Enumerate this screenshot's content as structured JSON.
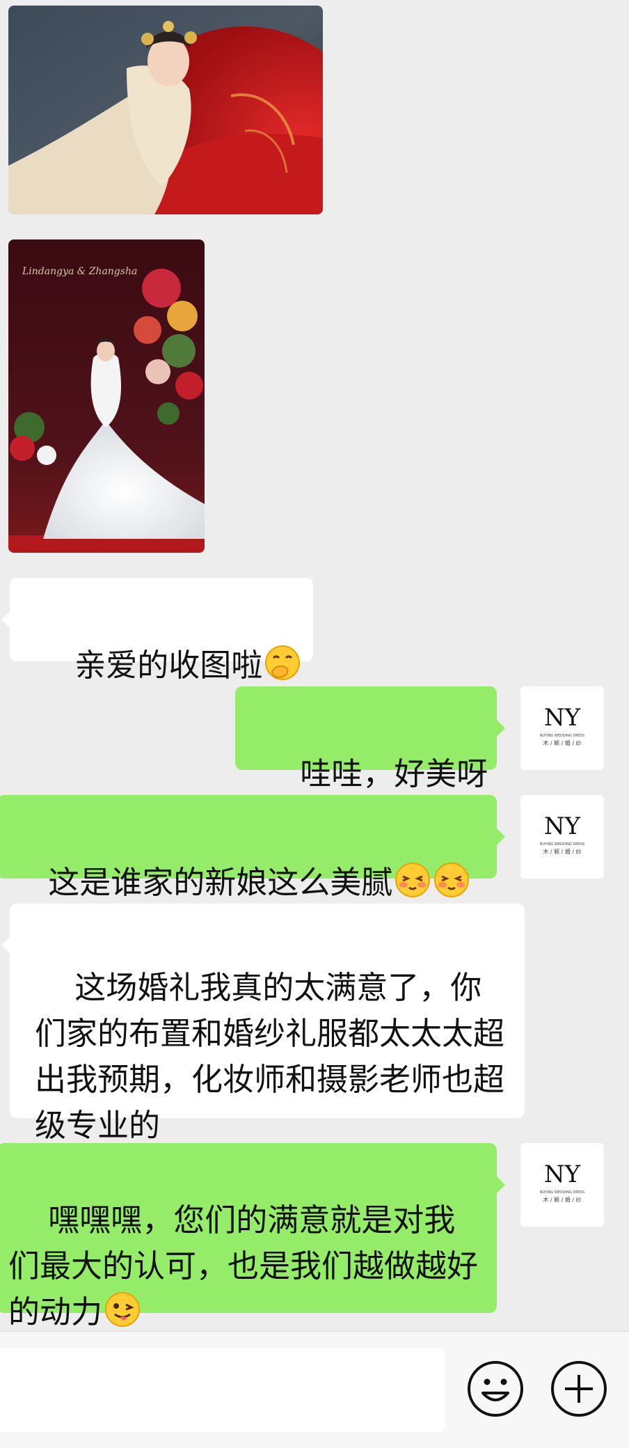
{
  "messages": {
    "msg_text_1": "亲爱的收图啦",
    "msg_text_2": "哇哇，好美呀",
    "msg_text_3": "这是谁家的新娘这么美腻",
    "msg_text_4": "这场婚礼我真的太满意了，你们家的布置和婚纱礼服都太太太超出我预期，化妆师和摄影老师也超级专业的",
    "msg_text_5": "嘿嘿嘿，您们的满意就是对我们最大的认可，也是我们越做越好的动力"
  },
  "avatar": {
    "logo_text": "NY",
    "brand_en": "NUYING WEDDING DRESS",
    "brand_cn": "木 / 颖 / 婚 / 纱"
  },
  "photo2": {
    "script_text": "Lindangya & Zhangsha"
  },
  "input_bar": {
    "placeholder": ""
  },
  "colors": {
    "background": "#ededed",
    "bubble_green": "#95ec69",
    "bubble_white": "#ffffff"
  },
  "icons": [
    "smiley-face-icon",
    "plus-circle-icon",
    "hand-over-mouth-emoji",
    "shy-flushed-emoji",
    "winking-tongue-emoji"
  ]
}
